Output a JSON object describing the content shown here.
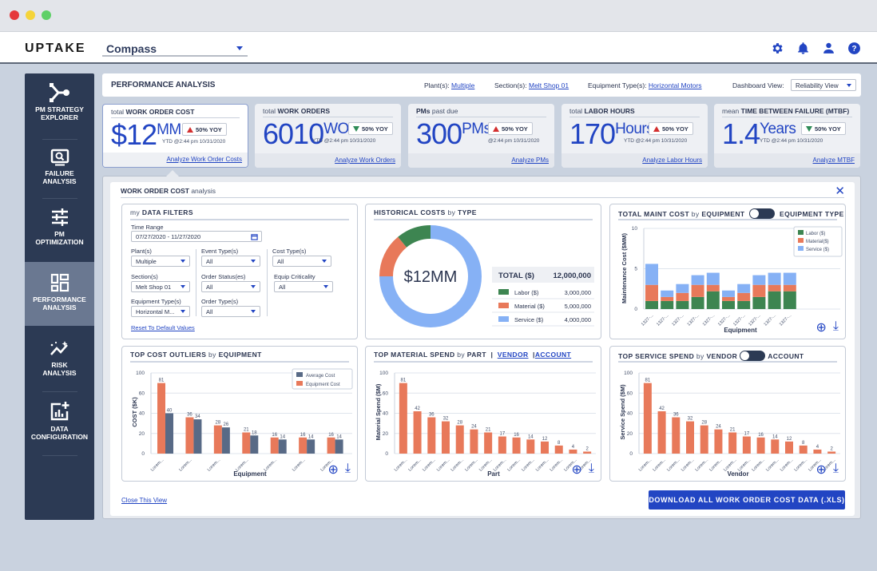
{
  "window": {
    "controls": [
      "close",
      "minimize",
      "maximize"
    ],
    "colors": {
      "close": "#e5393c",
      "minimize": "#f5d43a",
      "maximize": "#5fd068"
    }
  },
  "topbar": {
    "logo": "UPTAKE",
    "app_selector": "Compass",
    "icons": [
      "gear-icon",
      "bell-icon",
      "user-icon",
      "help-icon"
    ]
  },
  "sidebar": {
    "items": [
      {
        "label_1": "PM STRATEGY",
        "label_2": "EXPLORER",
        "icon": "strategy-icon",
        "active": false
      },
      {
        "label_1": "FAILURE",
        "label_2": "ANALYSIS",
        "icon": "search-monitor-icon",
        "active": false
      },
      {
        "label_1": "PM",
        "label_2": "OPTIMIZATION",
        "icon": "sliders-icon",
        "active": false
      },
      {
        "label_1": "PERFORMANCE",
        "label_2": "ANALYSIS",
        "icon": "dashboard-icon",
        "active": true
      },
      {
        "label_1": "RISK",
        "label_2": "ANALYSIS",
        "icon": "trend-icon",
        "active": false
      },
      {
        "label_1": "DATA",
        "label_2": "CONFIGURATION",
        "icon": "chart-add-icon",
        "active": false
      }
    ]
  },
  "header": {
    "title": "PERFORMANCE ANALYSIS",
    "plants_label": "Plant(s):",
    "plants_value": "Multiple",
    "sections_label": "Section(s):",
    "sections_value": "Melt Shop 01",
    "equip_label": "Equipment Type(s):",
    "equip_value": "Horizontal Motors",
    "view_label": "Dashboard View:",
    "view_value": "Reliability View"
  },
  "kpis": [
    {
      "prefix": "total",
      "title": "WORK ORDER COST",
      "value": "$12",
      "unit": "MM",
      "trend": "up",
      "yoy": "50% YOY",
      "ytd": "YTD @2:44 pm 10/31/2020",
      "link": "Analyze Work Order Costs",
      "active": true
    },
    {
      "prefix": "total",
      "title": "WORK ORDERS",
      "value": "6010",
      "unit": "WOs",
      "trend": "down",
      "yoy": "50% YOY",
      "ytd": "YTD @2:44 pm 10/31/2020",
      "link": "Analyze Work Orders",
      "active": false
    },
    {
      "prefix": "past due",
      "title": "PMs",
      "value": "300",
      "unit": "PMs",
      "trend": "up",
      "yoy": "50% YOY",
      "ytd": "@2:44 pm 10/31/2020",
      "link": "Analyze PMs",
      "active": false
    },
    {
      "prefix": "total",
      "title": "LABOR HOURS",
      "value": "170",
      "unit": "Hours",
      "trend": "up",
      "yoy": "50% YOY",
      "ytd": "YTD @2:44 pm 10/31/2020",
      "link": "Analyze Labor Hours",
      "active": false
    },
    {
      "prefix": "mean",
      "title": "TIME BETWEEN FAILURE (MTBF)",
      "value": "1.4",
      "unit": "Years",
      "trend": "down",
      "yoy": "50% YOY",
      "ytd": "YTD @2:44 pm 10/31/2020",
      "link": "Analyze MTBF",
      "active": false
    }
  ],
  "panel": {
    "title_bold": "WORK ORDER COST",
    "title_rest": "analysis",
    "close_link": "Close This View",
    "download_button": "DOWNLOAD ALL WORK ORDER COST DATA (.XLS)"
  },
  "filters": {
    "title_pre": "my",
    "title": "DATA FILTERS",
    "time_range_label": "Time Range",
    "time_range_value": "07/27/2020 - 11/27/2020",
    "fields": [
      {
        "label": "Plant(s)",
        "value": "Multiple"
      },
      {
        "label": "Section(s)",
        "value": "Melt Shop 01"
      },
      {
        "label": "Equipment Type(s)",
        "value": "Horizontal M..."
      },
      {
        "label": "Event Type(s)",
        "value": "All"
      },
      {
        "label": "Order Status(es)",
        "value": "All"
      },
      {
        "label": "Order Type(s)",
        "value": "All"
      },
      {
        "label": "Cost Type(s)",
        "value": "All"
      },
      {
        "label": "Equip Criticality",
        "value": "All"
      }
    ],
    "reset_link": "Reset To Default Values"
  },
  "colors": {
    "accent": "#2245c3",
    "labor": "#3d8551",
    "material": "#e8795a",
    "service": "#86b1f5",
    "average": "#586a86",
    "sidebar": "#2c3a54"
  },
  "chart_data": [
    {
      "type": "pie",
      "title": "HISTORICAL COSTS by TYPE",
      "center_label": "$12MM",
      "total_label": "TOTAL ($)",
      "total_value": "12,000,000",
      "slices": [
        {
          "name": "Labor ($)",
          "value": 3000000,
          "display": "3,000,000",
          "visual_share": 0.11
        },
        {
          "name": "Material ($)",
          "value": 5000000,
          "display": "5,000,000",
          "visual_share": 0.14
        },
        {
          "name": "Service ($)",
          "value": 4000000,
          "display": "4,000,000",
          "visual_share": 0.75
        }
      ]
    },
    {
      "type": "bar",
      "stacked": true,
      "title": "TOTAL MAINT COST by EQUIPMENT",
      "toggle_right": "EQUIPMENT TYPE",
      "xlabel": "Equipment",
      "ylabel": "Maintenance Cost ($MM)",
      "ylim": [
        0,
        10
      ],
      "yticks": [
        0,
        5,
        10
      ],
      "categories": [
        "1327-...",
        "1327-...",
        "1327-...",
        "1327-...",
        "1327-...",
        "1327-...",
        "1327-...",
        "1327-...",
        "1327-...",
        "1327-..."
      ],
      "series": [
        {
          "name": "Labor ($)",
          "values": [
            1.0,
            1.0,
            1.0,
            1.5,
            2.2,
            1.0,
            1.0,
            1.5,
            2.2,
            2.2
          ]
        },
        {
          "name": "Material($)",
          "values": [
            2.0,
            0.5,
            1.0,
            1.5,
            0.8,
            0.5,
            1.0,
            1.5,
            0.8,
            0.8
          ]
        },
        {
          "name": "Service ($)",
          "values": [
            2.6,
            0.8,
            1.1,
            1.2,
            1.5,
            0.8,
            1.1,
            1.2,
            1.5,
            1.5
          ]
        }
      ],
      "legend": "top-right"
    },
    {
      "type": "bar",
      "title": "TOP COST OUTLIERS by EQUIPMENT",
      "xlabel": "Equipment",
      "ylabel": "COST ($K)",
      "ytick_labels": [
        "0",
        "20",
        "40",
        "60",
        "100"
      ],
      "categories": [
        "Lorem...",
        "Lorem...",
        "Lorem...",
        "Lorem...",
        "Lorem...",
        "Lorem...",
        "Lorem..."
      ],
      "series": [
        {
          "name": "Equipment Cost",
          "values": [
            81,
            36,
            28,
            21,
            16,
            16,
            16
          ]
        },
        {
          "name": "Average Cost",
          "values": [
            40,
            34,
            26,
            18,
            14,
            14,
            14
          ]
        }
      ],
      "legend": "top-right"
    },
    {
      "type": "bar",
      "title": "TOP MATERIAL SPEND by PART",
      "links": [
        "VENDOR",
        "ACCOUNT"
      ],
      "xlabel": "Part",
      "ylabel": "Material Spend ($M)",
      "ytick_labels": [
        "0",
        "20",
        "40",
        "60",
        "100"
      ],
      "categories": [
        "Lorem...",
        "Lorem...",
        "Lorem...",
        "Lorem...",
        "Lorem...",
        "Lorem...",
        "Lorem...",
        "Lorem...",
        "Lorem...",
        "Lorem...",
        "Lorem...",
        "Lorem...",
        "Lorem...",
        "Lorem..."
      ],
      "values": [
        81,
        42,
        36,
        32,
        28,
        24,
        21,
        17,
        16,
        14,
        12,
        8,
        4,
        2
      ]
    },
    {
      "type": "bar",
      "title": "TOP SERVICE SPEND by VENDOR",
      "toggle_right": "ACCOUNT",
      "xlabel": "Vendor",
      "ylabel": "Service Spend ($M)",
      "ytick_labels": [
        "0",
        "20",
        "40",
        "60",
        "100"
      ],
      "categories": [
        "Lorem...",
        "Lorem...",
        "Lorem...",
        "Lorem...",
        "Lorem...",
        "Lorem...",
        "Lorem...",
        "Lorem...",
        "Lorem...",
        "Lorem...",
        "Lorem...",
        "Lorem...",
        "Lorem...",
        "Lorem..."
      ],
      "values": [
        81,
        42,
        36,
        32,
        28,
        24,
        21,
        17,
        16,
        14,
        12,
        8,
        4,
        2
      ]
    }
  ]
}
